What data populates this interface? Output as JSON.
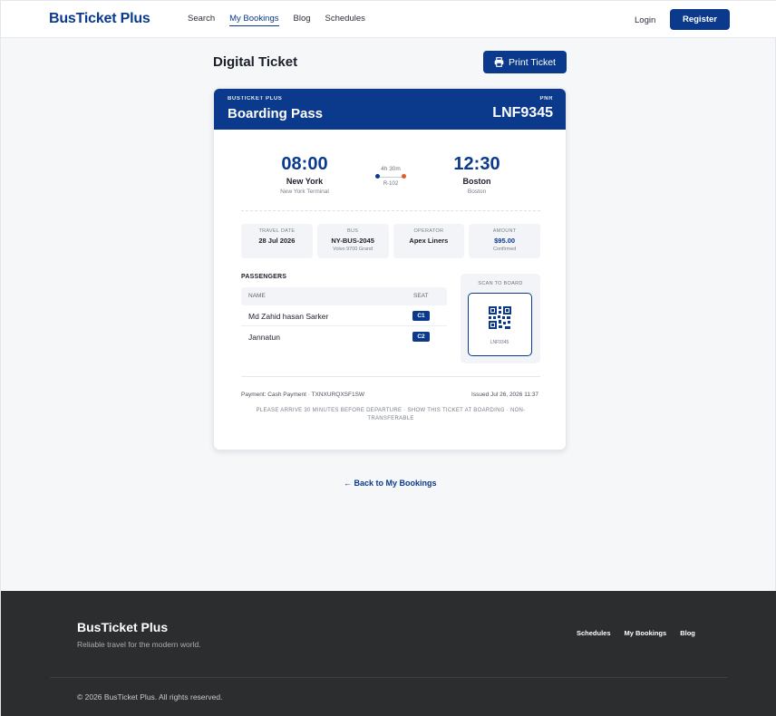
{
  "header": {
    "brand": "BusTicket Plus",
    "nav": [
      "Search",
      "My Bookings",
      "Blog",
      "Schedules"
    ],
    "active_nav": "My Bookings",
    "login": "Login",
    "register": "Register"
  },
  "page": {
    "title": "Digital Ticket",
    "print_label": "Print Ticket",
    "back_label": "← Back to My Bookings"
  },
  "ticket": {
    "brand": "BUSTICKET PLUS",
    "title": "Boarding Pass",
    "pnr_label": "PNR",
    "pnr": "LNF9345",
    "departure": {
      "time": "08:00",
      "city": "New York",
      "terminal": "New York Terminal"
    },
    "arrival": {
      "time": "12:30",
      "city": "Boston",
      "terminal": "Boston"
    },
    "duration": "4h 30m",
    "route_no": "R-102",
    "info": [
      {
        "label": "TRAVEL DATE",
        "value": "28 Jul 2026",
        "sub": ""
      },
      {
        "label": "BUS",
        "value": "NY-BUS-2045",
        "sub": "Volvo 9700 Grand"
      },
      {
        "label": "OPERATOR",
        "value": "Apex Liners",
        "sub": ""
      },
      {
        "label": "AMOUNT",
        "value": "$95.00",
        "sub": "Confirmed"
      }
    ],
    "passengers_label": "PASSENGERS",
    "columns": {
      "name": "NAME",
      "seat": "SEAT"
    },
    "passengers": [
      {
        "name": "Md Zahid hasan Sarker",
        "seat": "C1"
      },
      {
        "name": "Jannatun",
        "seat": "C2"
      }
    ],
    "scan_label": "SCAN TO BOARD",
    "qr_pnr": "LNF9345",
    "payment": "Payment: Cash Payment · TXNXURQXSF1SW",
    "issued": "Issued Jul 26, 2026 11:37",
    "notice": "PLEASE ARRIVE 30 MINUTES BEFORE DEPARTURE · SHOW THIS TICKET AT BOARDING · NON-TRANSFERABLE"
  },
  "footer": {
    "brand": "BusTicket Plus",
    "tagline": "Reliable travel for the modern world.",
    "links": [
      "Schedules",
      "My Bookings",
      "Blog"
    ],
    "copyright": "© 2026 BusTicket Plus. All rights reserved."
  },
  "colors": {
    "primary": "#0b3a8c",
    "accent_dot": "#e25c2b",
    "footer_bg": "#2b2d2e",
    "page_bg": "#f6f7f9"
  },
  "icons": {
    "print": "printer-icon",
    "qr": "qr-code-icon"
  }
}
